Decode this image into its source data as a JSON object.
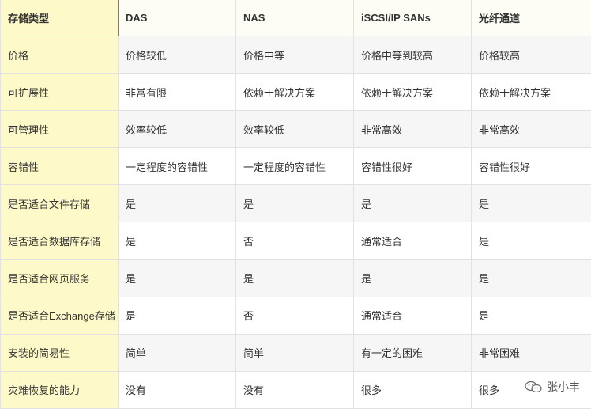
{
  "headers": [
    "存储类型",
    "DAS",
    "NAS",
    "iSCSI/IP SANs",
    "光纤通道"
  ],
  "rows": [
    [
      "价格",
      "价格较低",
      "价格中等",
      "价格中等到较高",
      "价格较高"
    ],
    [
      "可扩展性",
      "非常有限",
      "依赖于解决方案",
      "依赖于解决方案",
      "依赖于解决方案"
    ],
    [
      "可管理性",
      "效率较低",
      "效率较低",
      "非常高效",
      "非常高效"
    ],
    [
      "容错性",
      "一定程度的容错性",
      "一定程度的容错性",
      "容错性很好",
      "容错性很好"
    ],
    [
      "是否适合文件存储",
      "是",
      "是",
      "是",
      "是"
    ],
    [
      "是否适合数据库存储",
      "是",
      "否",
      "通常适合",
      "是"
    ],
    [
      "是否适合网页服务",
      "是",
      "是",
      "是",
      "是"
    ],
    [
      "是否适合Exchange存储",
      "是",
      "否",
      "通常适合",
      "是"
    ],
    [
      "安装的简易性",
      "简单",
      "简单",
      "有一定的困难",
      "非常困难"
    ],
    [
      "灾难恢复的能力",
      "没有",
      "没有",
      "很多",
      "很多"
    ]
  ],
  "watermark": {
    "icon": "wechat-icon",
    "text": "张小丰"
  },
  "colors": {
    "first_column": "#fdf9c8",
    "alt_row": "#f6f6f6",
    "border": "#e2e2e2"
  }
}
